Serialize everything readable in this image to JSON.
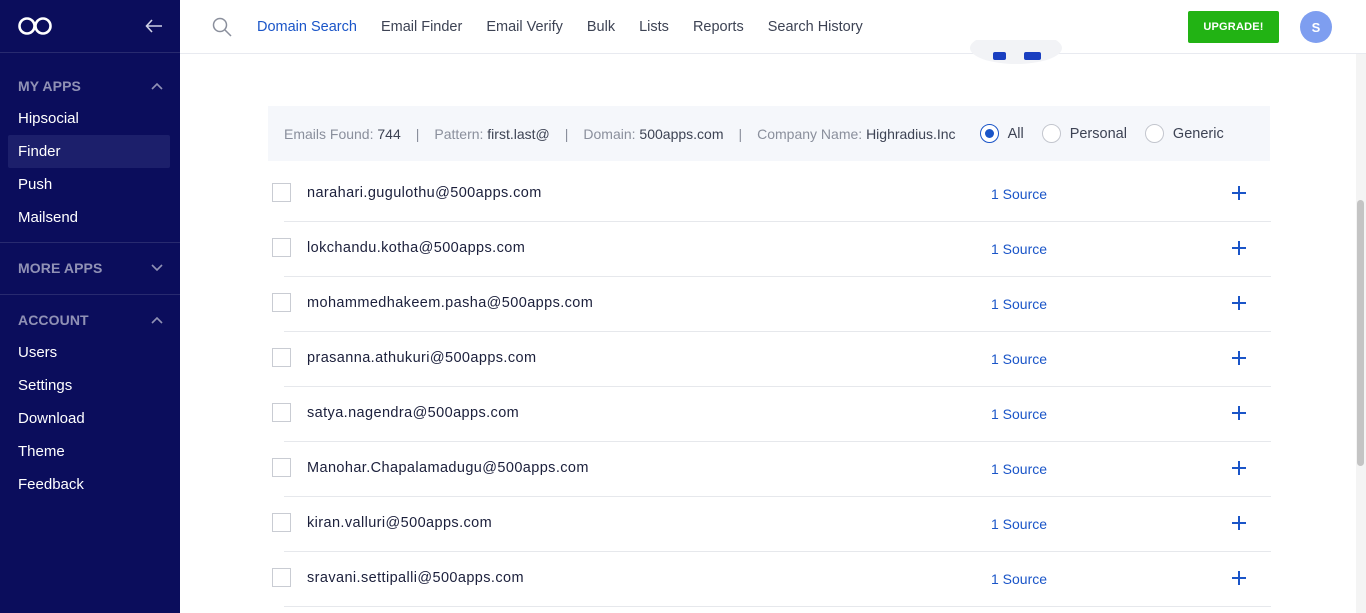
{
  "sidebar": {
    "my_apps": {
      "heading": "MY APPS",
      "items": [
        "Hipsocial",
        "Finder",
        "Push",
        "Mailsend"
      ]
    },
    "more_apps": {
      "heading": "MORE APPS"
    },
    "account": {
      "heading": "ACCOUNT",
      "items": [
        "Users",
        "Settings",
        "Download",
        "Theme",
        "Feedback"
      ]
    }
  },
  "nav": {
    "items": [
      "Domain Search",
      "Email Finder",
      "Email Verify",
      "Bulk",
      "Lists",
      "Reports",
      "Search History"
    ],
    "active": "Domain Search",
    "upgrade_label": "UPGRADE!",
    "avatar_initial": "S"
  },
  "filter": {
    "emails_found_label": "Emails Found:",
    "emails_found_value": "744",
    "pattern_label": "Pattern:",
    "pattern_value": "first.last@",
    "domain_label": "Domain:",
    "domain_value": "500apps.com",
    "company_label": "Company Name:",
    "company_value": "Highradius.Inc",
    "separator": "|",
    "radios": [
      "All",
      "Personal",
      "Generic"
    ],
    "selected": "All"
  },
  "emails": [
    {
      "address": "narahari.gugulothu@500apps.com",
      "source": "1 Source"
    },
    {
      "address": "lokchandu.kotha@500apps.com",
      "source": "1 Source"
    },
    {
      "address": "mohammedhakeem.pasha@500apps.com",
      "source": "1 Source"
    },
    {
      "address": "prasanna.athukuri@500apps.com",
      "source": "1 Source"
    },
    {
      "address": "satya.nagendra@500apps.com",
      "source": "1 Source"
    },
    {
      "address": "Manohar.Chapalamadugu@500apps.com",
      "source": "1 Source"
    },
    {
      "address": "kiran.valluri@500apps.com",
      "source": "1 Source"
    },
    {
      "address": "sravani.settipalli@500apps.com",
      "source": "1 Source"
    }
  ],
  "colors": {
    "sidebar_bg": "#0b0d5c",
    "accent": "#1a55c8",
    "upgrade_green": "#22b314",
    "avatar": "#7e9ef0"
  },
  "icons": {
    "logo": "infinity-logo-icon",
    "collapse": "arrow-left-icon",
    "search": "search-icon",
    "add": "plus-icon",
    "chevron_up": "chevron-up-icon",
    "chevron_down": "chevron-down-icon"
  }
}
